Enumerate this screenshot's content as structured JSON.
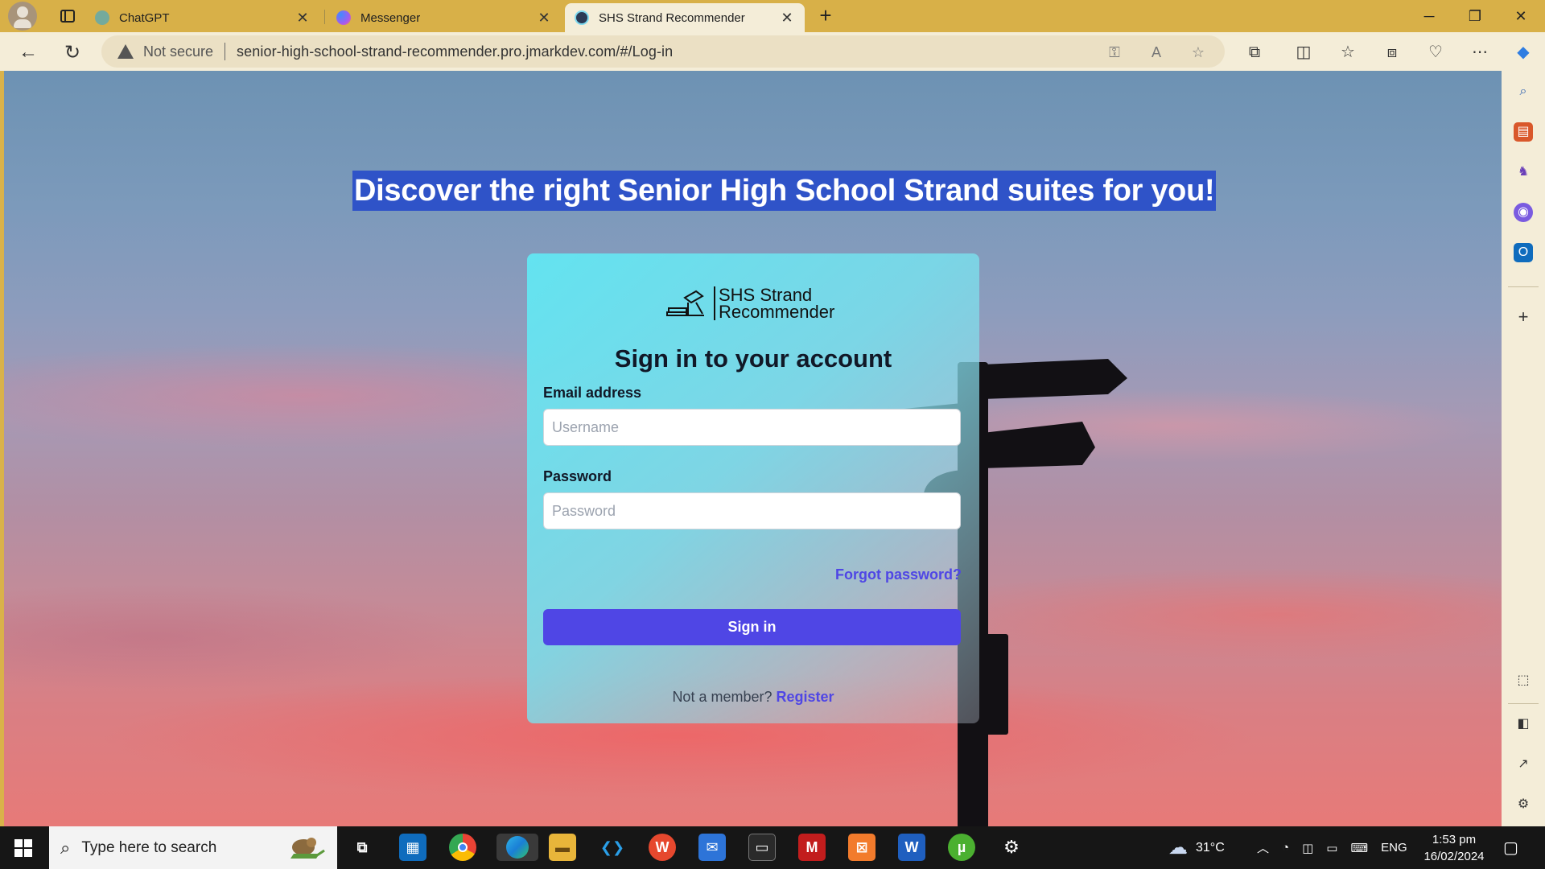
{
  "browser": {
    "tabs": [
      {
        "label": "ChatGPT",
        "favicon_color": "#74aa9c"
      },
      {
        "label": "Messenger",
        "favicon_color": "#a05cf0"
      },
      {
        "label": "SHS Strand Recommender",
        "favicon_color": "#2b3a55"
      }
    ],
    "address": {
      "security_label": "Not secure",
      "url": "senior-high-school-strand-recommender.pro.jmarkdev.com/#/Log-in"
    }
  },
  "page": {
    "headline": "Discover the right Senior High School Strand suites for you!",
    "logo": {
      "line1": "SHS Strand",
      "line2": "Recommender"
    },
    "title": "Sign in to your account",
    "email": {
      "label": "Email address",
      "placeholder": "Username"
    },
    "password": {
      "label": "Password",
      "placeholder": "Password"
    },
    "forgot_link": "Forgot password?",
    "signin_button": "Sign in",
    "member_text": "Not a member?",
    "register_link": "Register",
    "accent_color": "#4f46e5"
  },
  "taskbar": {
    "search_placeholder": "Type here to search",
    "weather": "31°C",
    "language": "ENG",
    "time": "1:53 pm",
    "date": "16/02/2024"
  }
}
